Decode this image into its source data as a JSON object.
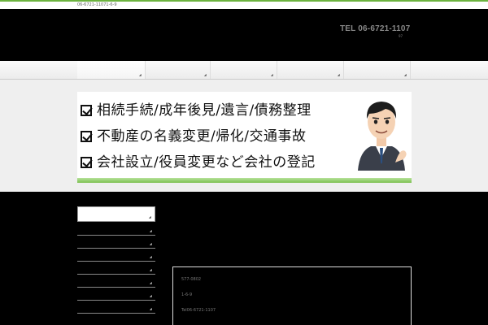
{
  "topbar": {
    "text": "06-6721-11071-6-9"
  },
  "header": {
    "tel": "TEL 06-6721-1107",
    "tel_sub": "97"
  },
  "nav": {
    "items": [
      {
        "active": true
      },
      {
        "active": false
      },
      {
        "active": false
      },
      {
        "active": false
      },
      {
        "active": false
      }
    ]
  },
  "banner": {
    "lines": [
      "相続手続/成年後見/遺言/債務整理",
      "不動産の名義変更/帰化/交通事故",
      "会社設立/役員変更など会社の登記"
    ],
    "accent_color": "#7cc050"
  },
  "info": {
    "postal": "577-0802",
    "address": "1-6-9",
    "tel": "Tel06-6721-1107"
  },
  "colors": {
    "accent": "#6cb33f",
    "background": "#000000"
  }
}
